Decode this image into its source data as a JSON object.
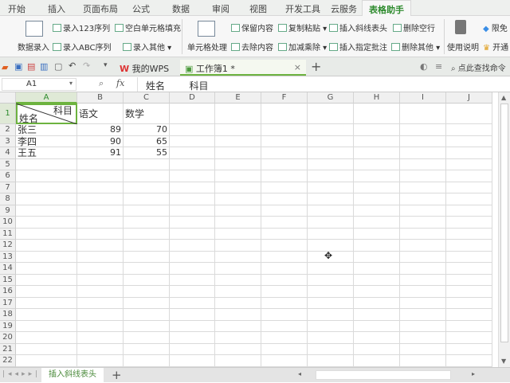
{
  "menu_tabs": [
    "开始",
    "插入",
    "页面布局",
    "公式",
    "数据",
    "审阅",
    "视图",
    "开发工具",
    "云服务",
    "表格助手"
  ],
  "active_tab": "表格助手",
  "ribbon": {
    "data_entry": "数据录入",
    "seq123": "录入123序列",
    "seqabc": "录入ABC序列",
    "blank_fill": "空白单元格填充",
    "entry_other": "录入其他",
    "cell_process": "单元格处理",
    "keep_content": "保留内容",
    "remove_content": "去除内容",
    "copy_paste": "复制粘贴",
    "add_sub_mul_div": "加减乘除",
    "insert_diagonal": "插入斜线表头",
    "insert_comment": "插入指定批注",
    "delete_empty_rows": "删除空行",
    "delete_other": "删除其他",
    "usage": "使用说明",
    "limited": "限免",
    "open": "开通"
  },
  "doc_tabs": [
    {
      "label": "我的WPS"
    },
    {
      "label": "工作簿1 *"
    }
  ],
  "search_cmd": "点此查找命令",
  "formula_bar": {
    "cell_ref": "A1",
    "fx": "fx",
    "content": "姓名        科目"
  },
  "columns": [
    "A",
    "B",
    "C",
    "D",
    "E",
    "F",
    "G",
    "H",
    "I",
    "J"
  ],
  "rows": 22,
  "cells": {
    "A1_top": "科目",
    "A1_bottom": "姓名",
    "B1": "语文",
    "C1": "数学",
    "data": [
      [
        "张三",
        "89",
        "70"
      ],
      [
        "李四",
        "90",
        "65"
      ],
      [
        "王五",
        "91",
        "55"
      ]
    ]
  },
  "sheet_tabs": [
    "插入斜线表头"
  ],
  "accent": "#2e8b2e"
}
